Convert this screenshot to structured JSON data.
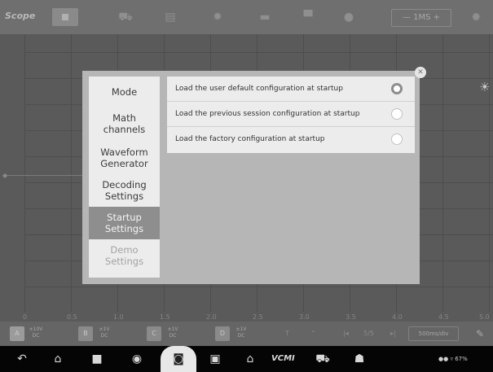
{
  "toolbar": {
    "logo": "Scope",
    "timebase": "—  1MS  +",
    "icons": [
      "stop-icon",
      "car-icon",
      "report-icon",
      "gear-icon",
      "save-icon",
      "folder-icon",
      "help-icon",
      "settings-icon"
    ]
  },
  "scope": {
    "x_ticks": [
      "0",
      "0.5",
      "1.0",
      "1.5",
      "2.0",
      "2.5",
      "3.0",
      "3.5",
      "4.0",
      "4.5",
      "5.0"
    ]
  },
  "channels": [
    {
      "label": "A",
      "range": "±10V",
      "coupling": "DC",
      "color": "#9b9b9b"
    },
    {
      "label": "B",
      "range": "±1V",
      "coupling": "DC",
      "color": "#8a8a8a"
    },
    {
      "label": "C",
      "range": "±1V",
      "coupling": "DC",
      "color": "#8a8a8a"
    },
    {
      "label": "D",
      "range": "±1V",
      "coupling": "DC",
      "color": "#8a8a8a"
    }
  ],
  "bottom_controls": {
    "page": "5/5",
    "time_per_div": "500ms/div"
  },
  "dialog": {
    "menu": [
      {
        "label": "Mode"
      },
      {
        "label": "Math\nchannels"
      },
      {
        "label": "Waveform\nGenerator"
      },
      {
        "label": "Decoding\nSettings"
      },
      {
        "label": "Startup\nSettings"
      },
      {
        "label": "Demo\nSettings"
      }
    ],
    "selected_index": 4,
    "options": [
      {
        "label": "Load the user default configuration at startup",
        "selected": true
      },
      {
        "label": "Load the previous session configuration at startup",
        "selected": false
      },
      {
        "label": "Load the factory configuration at startup",
        "selected": false
      }
    ]
  },
  "navbar": {
    "vcm": "VCMI",
    "status": "67%"
  }
}
